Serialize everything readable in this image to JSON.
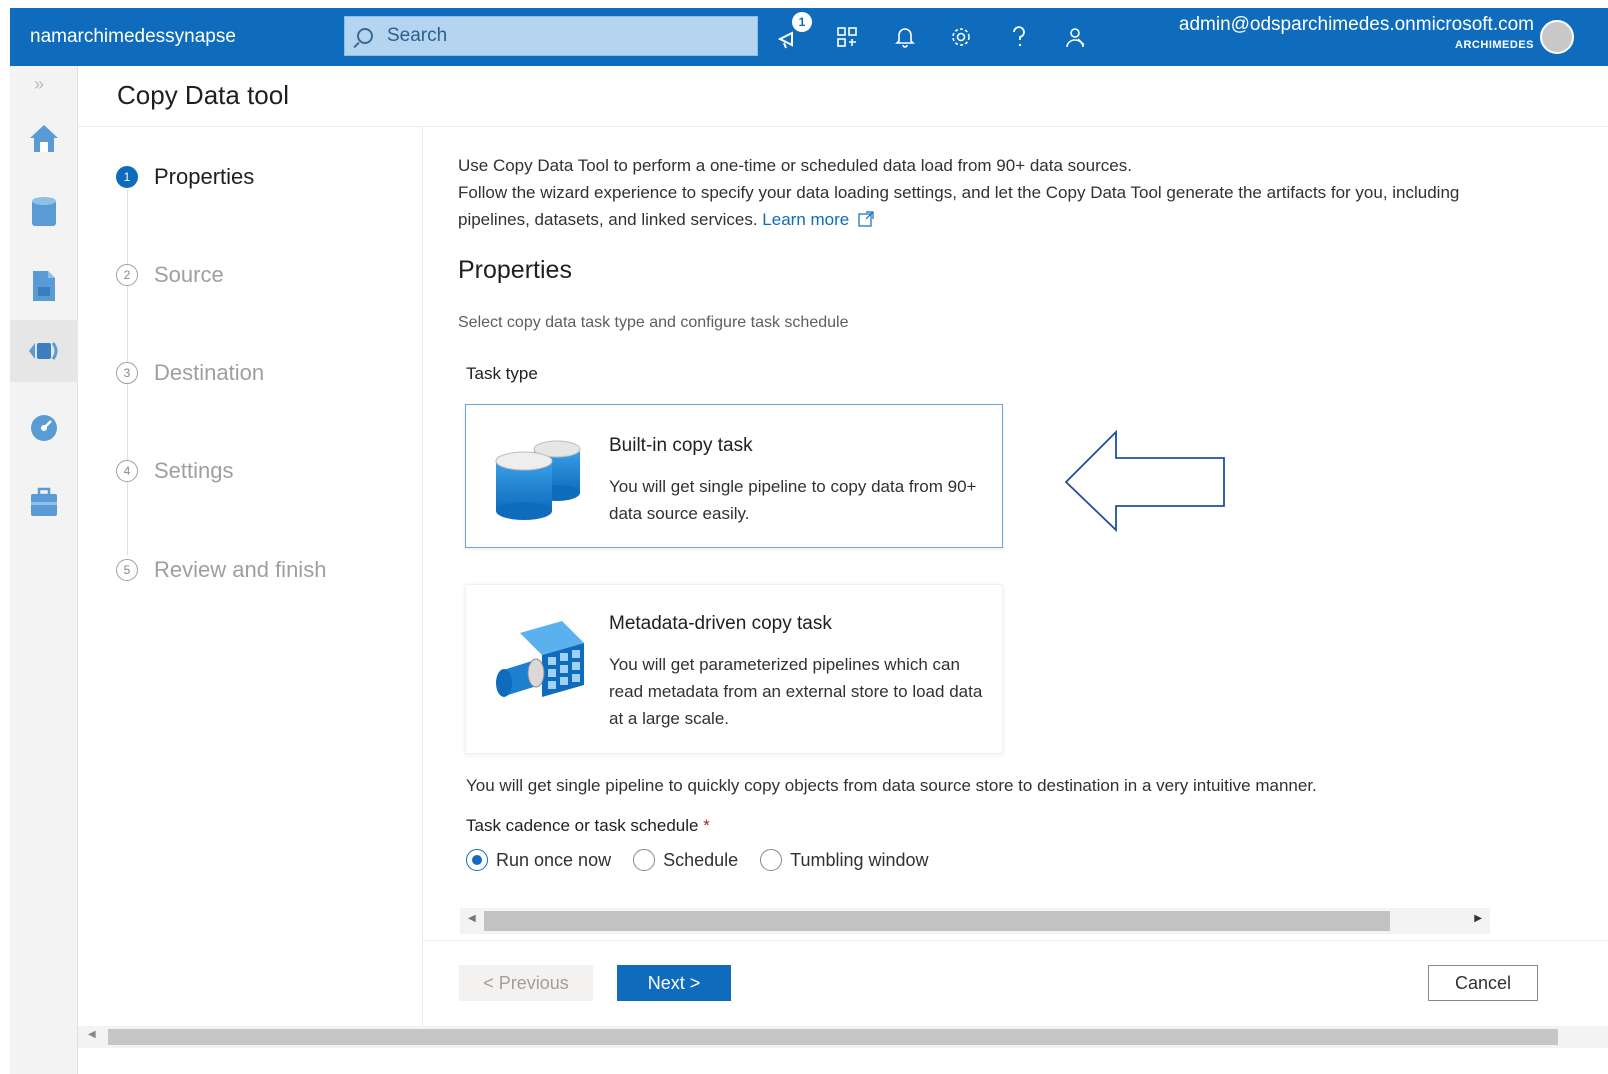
{
  "topbar": {
    "workspace": "namarchimedessynapse",
    "search_placeholder": "Search",
    "notification_count": "1",
    "account_email": "admin@odsparchimedes.onmicrosoft.com",
    "tenant": "ARCHIMEDES",
    "brand_color": "#0f6cbd"
  },
  "rail": {
    "items": [
      "home-icon",
      "data-icon",
      "develop-icon",
      "integrate-icon",
      "monitor-icon",
      "manage-icon"
    ]
  },
  "header": {
    "title": "Copy Data tool"
  },
  "steps": [
    {
      "num": "1",
      "label": "Properties",
      "active": true
    },
    {
      "num": "2",
      "label": "Source",
      "active": false
    },
    {
      "num": "3",
      "label": "Destination",
      "active": false
    },
    {
      "num": "4",
      "label": "Settings",
      "active": false
    },
    {
      "num": "5",
      "label": "Review and finish",
      "active": false
    }
  ],
  "intro": {
    "line1": "Use Copy Data Tool to perform a one-time or scheduled data load from 90+ data sources.",
    "line2": "Follow the wizard experience to specify your data loading settings, and let the Copy Data Tool generate the artifacts for you, including pipelines, datasets, and linked services.",
    "learn_more": "Learn more"
  },
  "properties": {
    "heading": "Properties",
    "description": "Select copy data task type and configure task schedule",
    "task_type_label": "Task type",
    "cards": [
      {
        "title": "Built-in copy task",
        "description": "You will get single pipeline to copy data from 90+ data source easily.",
        "selected": true
      },
      {
        "title": "Metadata-driven copy task",
        "description": "You will get parameterized pipelines which can read metadata from an external store to load data at a large scale.",
        "selected": false
      }
    ],
    "pipeline_note": "You will get single pipeline to quickly copy objects from data source store to destination in a very intuitive manner.",
    "cadence_label": "Task cadence or task schedule",
    "required_mark": "*",
    "cadence_options": [
      {
        "label": "Run once now",
        "selected": true
      },
      {
        "label": "Schedule",
        "selected": false
      },
      {
        "label": "Tumbling window",
        "selected": false
      }
    ]
  },
  "footer": {
    "previous": "< Previous",
    "next": "Next >",
    "cancel": "Cancel"
  }
}
